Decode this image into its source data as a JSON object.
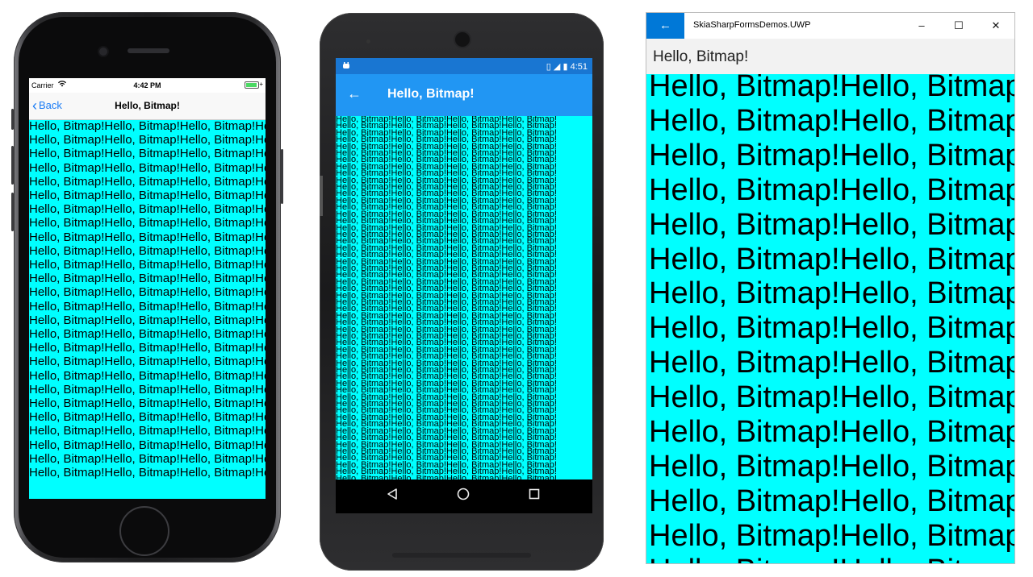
{
  "ios": {
    "carrier": "Carrier",
    "time": "4:42 PM",
    "back_label": "Back",
    "title": "Hello, Bitmap!",
    "tile_rows": 26
  },
  "android": {
    "time": "4:51",
    "title": "Hello, Bitmap!",
    "tile_rows": 54
  },
  "uwp": {
    "window_title": "SkiaSharpFormsDemos.UWP",
    "page_title": "Hello, Bitmap!",
    "tile_rows": 15
  },
  "bitmap": {
    "text": "Hello, Bitmap!",
    "background": "#00ffff",
    "text_color": "#000000"
  },
  "colors": {
    "ios_accent": "#1a7cf5",
    "android_status": "#1976d2",
    "android_bar": "#2196f3",
    "uwp_accent": "#0078d7"
  },
  "icons": {
    "ios_back": "chevron-left-icon",
    "android_back": "arrow-left-icon",
    "android_nav": [
      "back-triangle-icon",
      "home-circle-icon",
      "overview-square-icon"
    ],
    "uwp_back": "arrow-left-icon",
    "uwp_controls": [
      "minimize-icon",
      "maximize-icon",
      "close-icon"
    ]
  }
}
